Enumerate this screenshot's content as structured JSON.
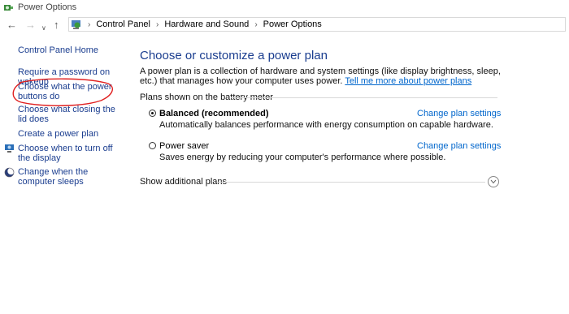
{
  "window": {
    "title": "Power Options"
  },
  "nav": {
    "back": "←",
    "forward": "→",
    "recent": "∨",
    "up": "↑"
  },
  "breadcrumb": {
    "items": [
      "Control Panel",
      "Hardware and Sound",
      "Power Options"
    ],
    "separator": "›"
  },
  "sidebar": {
    "home": "Control Panel Home",
    "links": [
      "Require a password on wakeup",
      "Choose what the power buttons do",
      "Choose what closing the lid does",
      "Create a power plan",
      "Choose when to turn off the display",
      "Change when the computer sleeps"
    ]
  },
  "main": {
    "heading": "Choose or customize a power plan",
    "description": "A power plan is a collection of hardware and system settings (like display brightness, sleep, etc.) that manages how your computer uses power.",
    "learn_more": "Tell me more about power plans",
    "section_label": "Plans shown on the battery meter",
    "plans": [
      {
        "name": "Balanced (recommended)",
        "selected": true,
        "description": "Automatically balances performance with energy consumption on capable hardware.",
        "change_label": "Change plan settings"
      },
      {
        "name": "Power saver",
        "selected": false,
        "description": "Saves energy by reducing your computer's performance where possible.",
        "change_label": "Change plan settings"
      }
    ],
    "show_more": "Show additional plans"
  },
  "colors": {
    "link": "#1a3d8f",
    "accent_link": "#0066cc",
    "annotation": "#e02020"
  }
}
